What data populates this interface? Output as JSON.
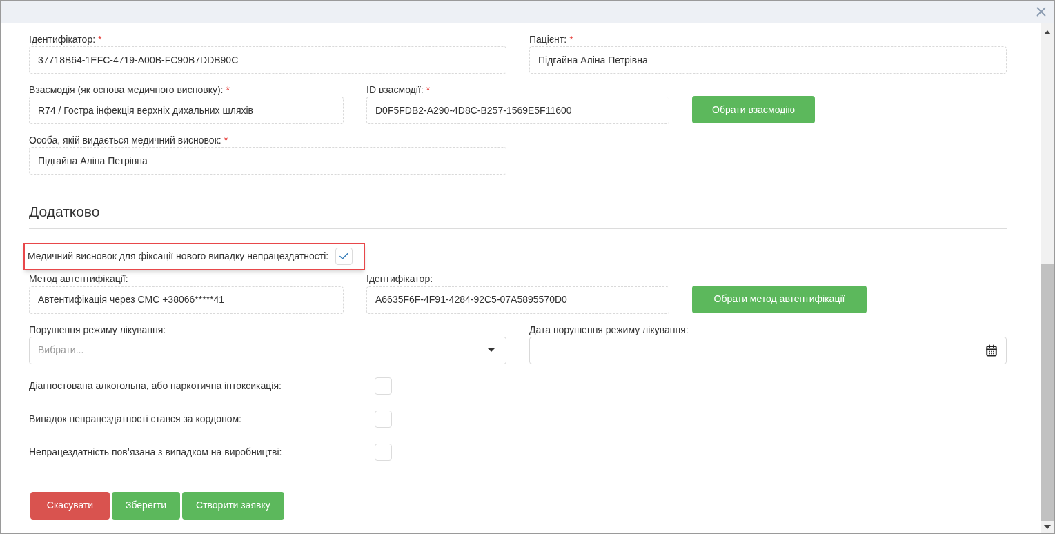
{
  "main": {
    "identifier": {
      "label": "Ідентифікатор:",
      "required_mark": "*",
      "value": "37718B64-1EFC-4719-A00B-FC90B7DDB90C"
    },
    "patient": {
      "label": "Пацієнт:",
      "required_mark": "*",
      "value": "Підгайна Аліна Петрівна"
    },
    "interaction": {
      "label": "Взаємодія (як основа медичного висновку):",
      "required_mark": "*",
      "value": "R74 / Гостра інфекція верхніх дихальних шляхів"
    },
    "interaction_id": {
      "label": "ID взаємодії:",
      "required_mark": "*",
      "value": "D0F5FDB2-A290-4D8C-B257-1569E5F11600"
    },
    "interaction_button": "Обрати взаємодію",
    "person": {
      "label": "Особа, якій видається медичний висновок:",
      "required_mark": "*",
      "value": "Підгайна Аліна Петрівна"
    }
  },
  "additional": {
    "title": "Додатково",
    "new_case": {
      "label": "Медичний висновок для фіксації нового випадку непрацездатності:",
      "checked": true,
      "highlighted": true
    },
    "auth_method": {
      "label": "Метод автентифікації:",
      "value": "Автентифікація через СМС +38066*****41"
    },
    "auth_id": {
      "label": "Ідентифікатор:",
      "value": "A6635F6F-4F91-4284-92C5-07A5895570D0"
    },
    "auth_button": "Обрати метод автентифікації",
    "violation": {
      "label": "Порушення режиму лікування:",
      "placeholder": "Вибрати..."
    },
    "violation_date": {
      "label": "Дата порушення режиму лікування:"
    },
    "flags": [
      {
        "label": "Діагностована алкогольна, або наркотична інтоксикація:",
        "checked": false
      },
      {
        "label": "Випадок непрацездатності стався за кордоном:",
        "checked": false
      },
      {
        "label": "Непрацездатність пов’язана з випадком на виробництві:",
        "checked": false
      }
    ]
  },
  "buttons": [
    {
      "kind": "danger",
      "label": "Скасувати"
    },
    {
      "kind": "primary",
      "label": "Зберегти"
    },
    {
      "kind": "primary",
      "label": "Створити заявку"
    }
  ]
}
